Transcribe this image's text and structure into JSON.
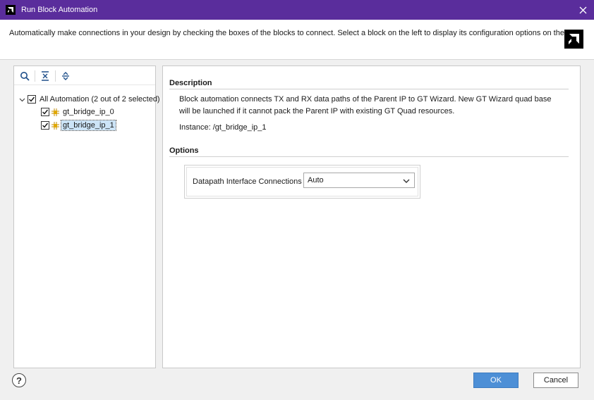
{
  "window": {
    "title": "Run Block Automation",
    "title_bar_color": "#5a2d9c"
  },
  "banner": {
    "message": "Automatically make connections in your design by checking the boxes of the blocks to connect. Select a block on the left to display its configuration options on the right."
  },
  "toolbar": {
    "icons": [
      "search-icon",
      "collapse-all-icon",
      "expand-all-icon"
    ]
  },
  "tree": {
    "root": {
      "label": "All Automation (2 out of 2 selected)",
      "checked": true,
      "expanded": true
    },
    "children": [
      {
        "label": "gt_bridge_ip_0",
        "checked": true,
        "selected": false
      },
      {
        "label": "gt_bridge_ip_1",
        "checked": true,
        "selected": true
      }
    ]
  },
  "details": {
    "description_title": "Description",
    "description_text": "Block automation connects TX and RX data paths of the Parent IP to GT Wizard. New GT Wizard quad base will be launched if it cannot pack the Parent IP with existing GT Quad resources.",
    "instance_text": "Instance: /gt_bridge_ip_1",
    "options_title": "Options",
    "option_label": "Datapath Interface Connections",
    "option_value": "Auto"
  },
  "footer": {
    "help_label": "?",
    "ok_label": "OK",
    "cancel_label": "Cancel",
    "ok_color": "#4d8fd6"
  }
}
